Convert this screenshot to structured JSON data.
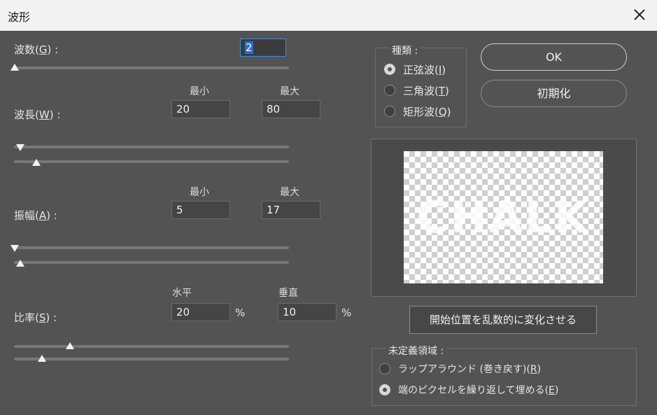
{
  "window": {
    "title": "波形"
  },
  "wave_count": {
    "label_text": "波数(",
    "mnemonic": "G",
    "label_suffix": ") :",
    "value": "2",
    "slider_fraction": 0.0
  },
  "column_headers": {
    "min": "最小",
    "max": "最大",
    "horizontal": "水平",
    "vertical": "垂直"
  },
  "wavelength": {
    "label_text": "波長(",
    "mnemonic": "W",
    "label_suffix": ") :",
    "min": "20",
    "max": "80",
    "min_fraction": 0.02,
    "max_fraction": 0.08
  },
  "amplitude": {
    "label_text": "振幅(",
    "mnemonic": "A",
    "label_suffix": ") :",
    "min": "5",
    "max": "17",
    "min_fraction": 0.0,
    "max_fraction": 0.02
  },
  "scale": {
    "label_text": "比率(",
    "mnemonic": "S",
    "label_suffix": ") :",
    "horizontal": "20",
    "vertical": "10",
    "unit": "%",
    "h_fraction": 0.2,
    "v_fraction": 0.1
  },
  "type_group": {
    "legend": "種類 :",
    "options": [
      {
        "text": "正弦波(",
        "mnemonic": "I",
        "suffix": ")",
        "selected": true
      },
      {
        "text": "三角波(",
        "mnemonic": "T",
        "suffix": ")",
        "selected": false
      },
      {
        "text": "矩形波(",
        "mnemonic": "Q",
        "suffix": ")",
        "selected": false
      }
    ]
  },
  "buttons": {
    "ok": "OK",
    "reset": "初期化",
    "randomize": "開始位置を乱数的に変化させる"
  },
  "preview": {
    "text": "CHALK"
  },
  "undefined_areas": {
    "legend": "未定義領域 :",
    "options": [
      {
        "text": "ラップアラウンド (巻き戻す)(",
        "mnemonic": "R",
        "suffix": ")",
        "selected": false
      },
      {
        "text": "端のピクセルを繰り返して埋める(",
        "mnemonic": "E",
        "suffix": ")",
        "selected": true
      }
    ]
  },
  "colors": {
    "background": "#535353",
    "titlebar": "#f3f3f3",
    "focus": "#3b8eea"
  }
}
